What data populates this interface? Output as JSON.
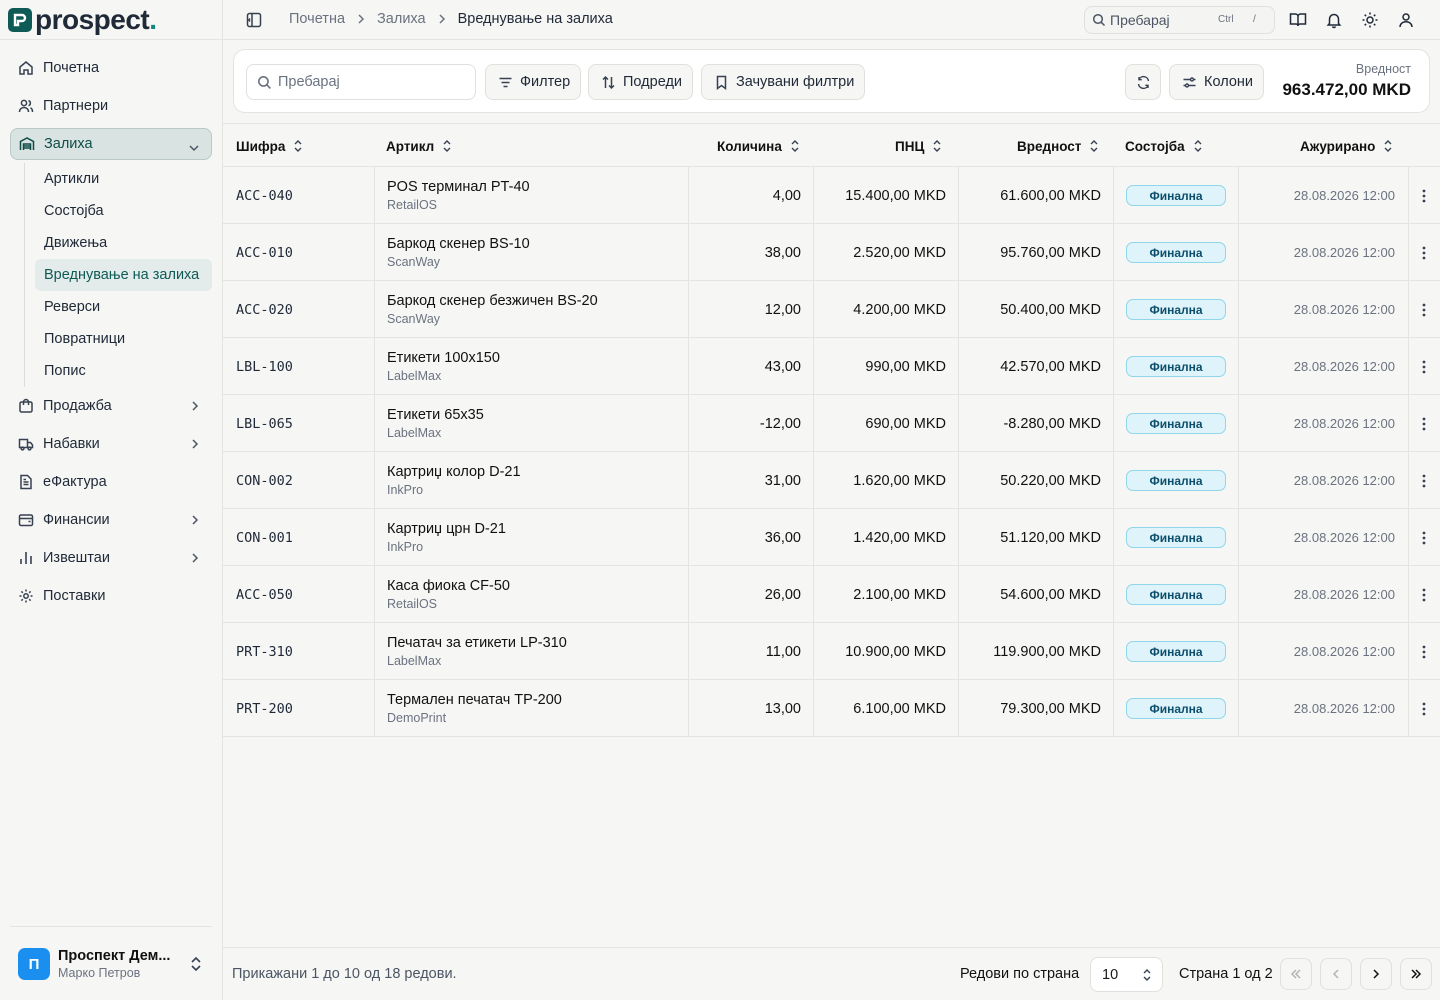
{
  "app": {
    "logo_text": "prospect",
    "logo_dot": "."
  },
  "sidebar": {
    "items": [
      {
        "label": "Почетна",
        "icon": "home-icon"
      },
      {
        "label": "Партнери",
        "icon": "users-icon"
      },
      {
        "label": "Залиха",
        "icon": "warehouse-icon",
        "expanded": true
      },
      {
        "label": "Продажба",
        "icon": "shopping-bag-icon"
      },
      {
        "label": "Набавки",
        "icon": "truck-icon"
      },
      {
        "label": "еФактура",
        "icon": "document-icon"
      },
      {
        "label": "Финансии",
        "icon": "wallet-icon"
      },
      {
        "label": "Извештаи",
        "icon": "bar-chart-icon"
      },
      {
        "label": "Поставки",
        "icon": "gear-icon"
      }
    ],
    "sub_items": [
      "Артикли",
      "Состојба",
      "Движења",
      "Вреднување на залиха",
      "Реверси",
      "Повратници",
      "Попис"
    ],
    "active_sub": "Вреднување на залиха",
    "user": {
      "initial": "П",
      "name": "Проспект Дем...",
      "sub": "Марко Петров"
    }
  },
  "topbar": {
    "breadcrumbs": [
      "Почетна",
      "Залиха",
      "Вреднување на залиха"
    ],
    "search_placeholder": "Пребарај",
    "shortcut_mod": "Ctrl",
    "shortcut_key": "/"
  },
  "toolbar": {
    "search_placeholder": "Пребарај",
    "filter_label": "Филтер",
    "sort_label": "Подреди",
    "saved_filters_label": "Зачувани филтри",
    "columns_label": "Колони",
    "total_label": "Вредност",
    "total_value": "963.472,00 MKD"
  },
  "table": {
    "headers": {
      "code": "Шифра",
      "article": "Артикл",
      "qty": "Количина",
      "price": "ПНЦ",
      "value": "Вредност",
      "status": "Состојба",
      "updated": "Ажурирано"
    },
    "rows": [
      {
        "code": "ACC-040",
        "name": "POS терминал PT-40",
        "brand": "RetailOS",
        "qty": "4,00",
        "price": "15.400,00 MKD",
        "value": "61.600,00 MKD",
        "status": "Финална",
        "updated": "28.08.2026 12:00"
      },
      {
        "code": "ACC-010",
        "name": "Баркод скенер BS-10",
        "brand": "ScanWay",
        "qty": "38,00",
        "price": "2.520,00 MKD",
        "value": "95.760,00 MKD",
        "status": "Финална",
        "updated": "28.08.2026 12:00"
      },
      {
        "code": "ACC-020",
        "name": "Баркод скенер безжичен BS-20",
        "brand": "ScanWay",
        "qty": "12,00",
        "price": "4.200,00 MKD",
        "value": "50.400,00 MKD",
        "status": "Финална",
        "updated": "28.08.2026 12:00"
      },
      {
        "code": "LBL-100",
        "name": "Етикети 100x150",
        "brand": "LabelMax",
        "qty": "43,00",
        "price": "990,00 MKD",
        "value": "42.570,00 MKD",
        "status": "Финална",
        "updated": "28.08.2026 12:00"
      },
      {
        "code": "LBL-065",
        "name": "Етикети 65x35",
        "brand": "LabelMax",
        "qty": "-12,00",
        "price": "690,00 MKD",
        "value": "-8.280,00 MKD",
        "status": "Финална",
        "updated": "28.08.2026 12:00"
      },
      {
        "code": "CON-002",
        "name": "Картриџ колор D-21",
        "brand": "InkPro",
        "qty": "31,00",
        "price": "1.620,00 MKD",
        "value": "50.220,00 MKD",
        "status": "Финална",
        "updated": "28.08.2026 12:00"
      },
      {
        "code": "CON-001",
        "name": "Картриџ црн D-21",
        "brand": "InkPro",
        "qty": "36,00",
        "price": "1.420,00 MKD",
        "value": "51.120,00 MKD",
        "status": "Финална",
        "updated": "28.08.2026 12:00"
      },
      {
        "code": "ACC-050",
        "name": "Каса фиока CF-50",
        "brand": "RetailOS",
        "qty": "26,00",
        "price": "2.100,00 MKD",
        "value": "54.600,00 MKD",
        "status": "Финална",
        "updated": "28.08.2026 12:00"
      },
      {
        "code": "PRT-310",
        "name": "Печатач за етикети LP-310",
        "brand": "LabelMax",
        "qty": "11,00",
        "price": "10.900,00 MKD",
        "value": "119.900,00 MKD",
        "status": "Финална",
        "updated": "28.08.2026 12:00"
      },
      {
        "code": "PRT-200",
        "name": "Термален печатач TP-200",
        "brand": "DemoPrint",
        "qty": "13,00",
        "price": "6.100,00 MKD",
        "value": "79.300,00 MKD",
        "status": "Финална",
        "updated": "28.08.2026 12:00"
      }
    ]
  },
  "footer": {
    "info": "Прикажани 1 до 10 од 18 редови.",
    "rows_per_page_label": "Редови по страна",
    "rows_per_page": "10",
    "page_info": "Страна 1 од 2"
  },
  "colors": {
    "brand": "#0e5a56",
    "accent": "#0e8a7e",
    "badge_bg": "#dff3fa",
    "badge_border": "#8fd6ea",
    "avatar": "#1a8ff0"
  }
}
